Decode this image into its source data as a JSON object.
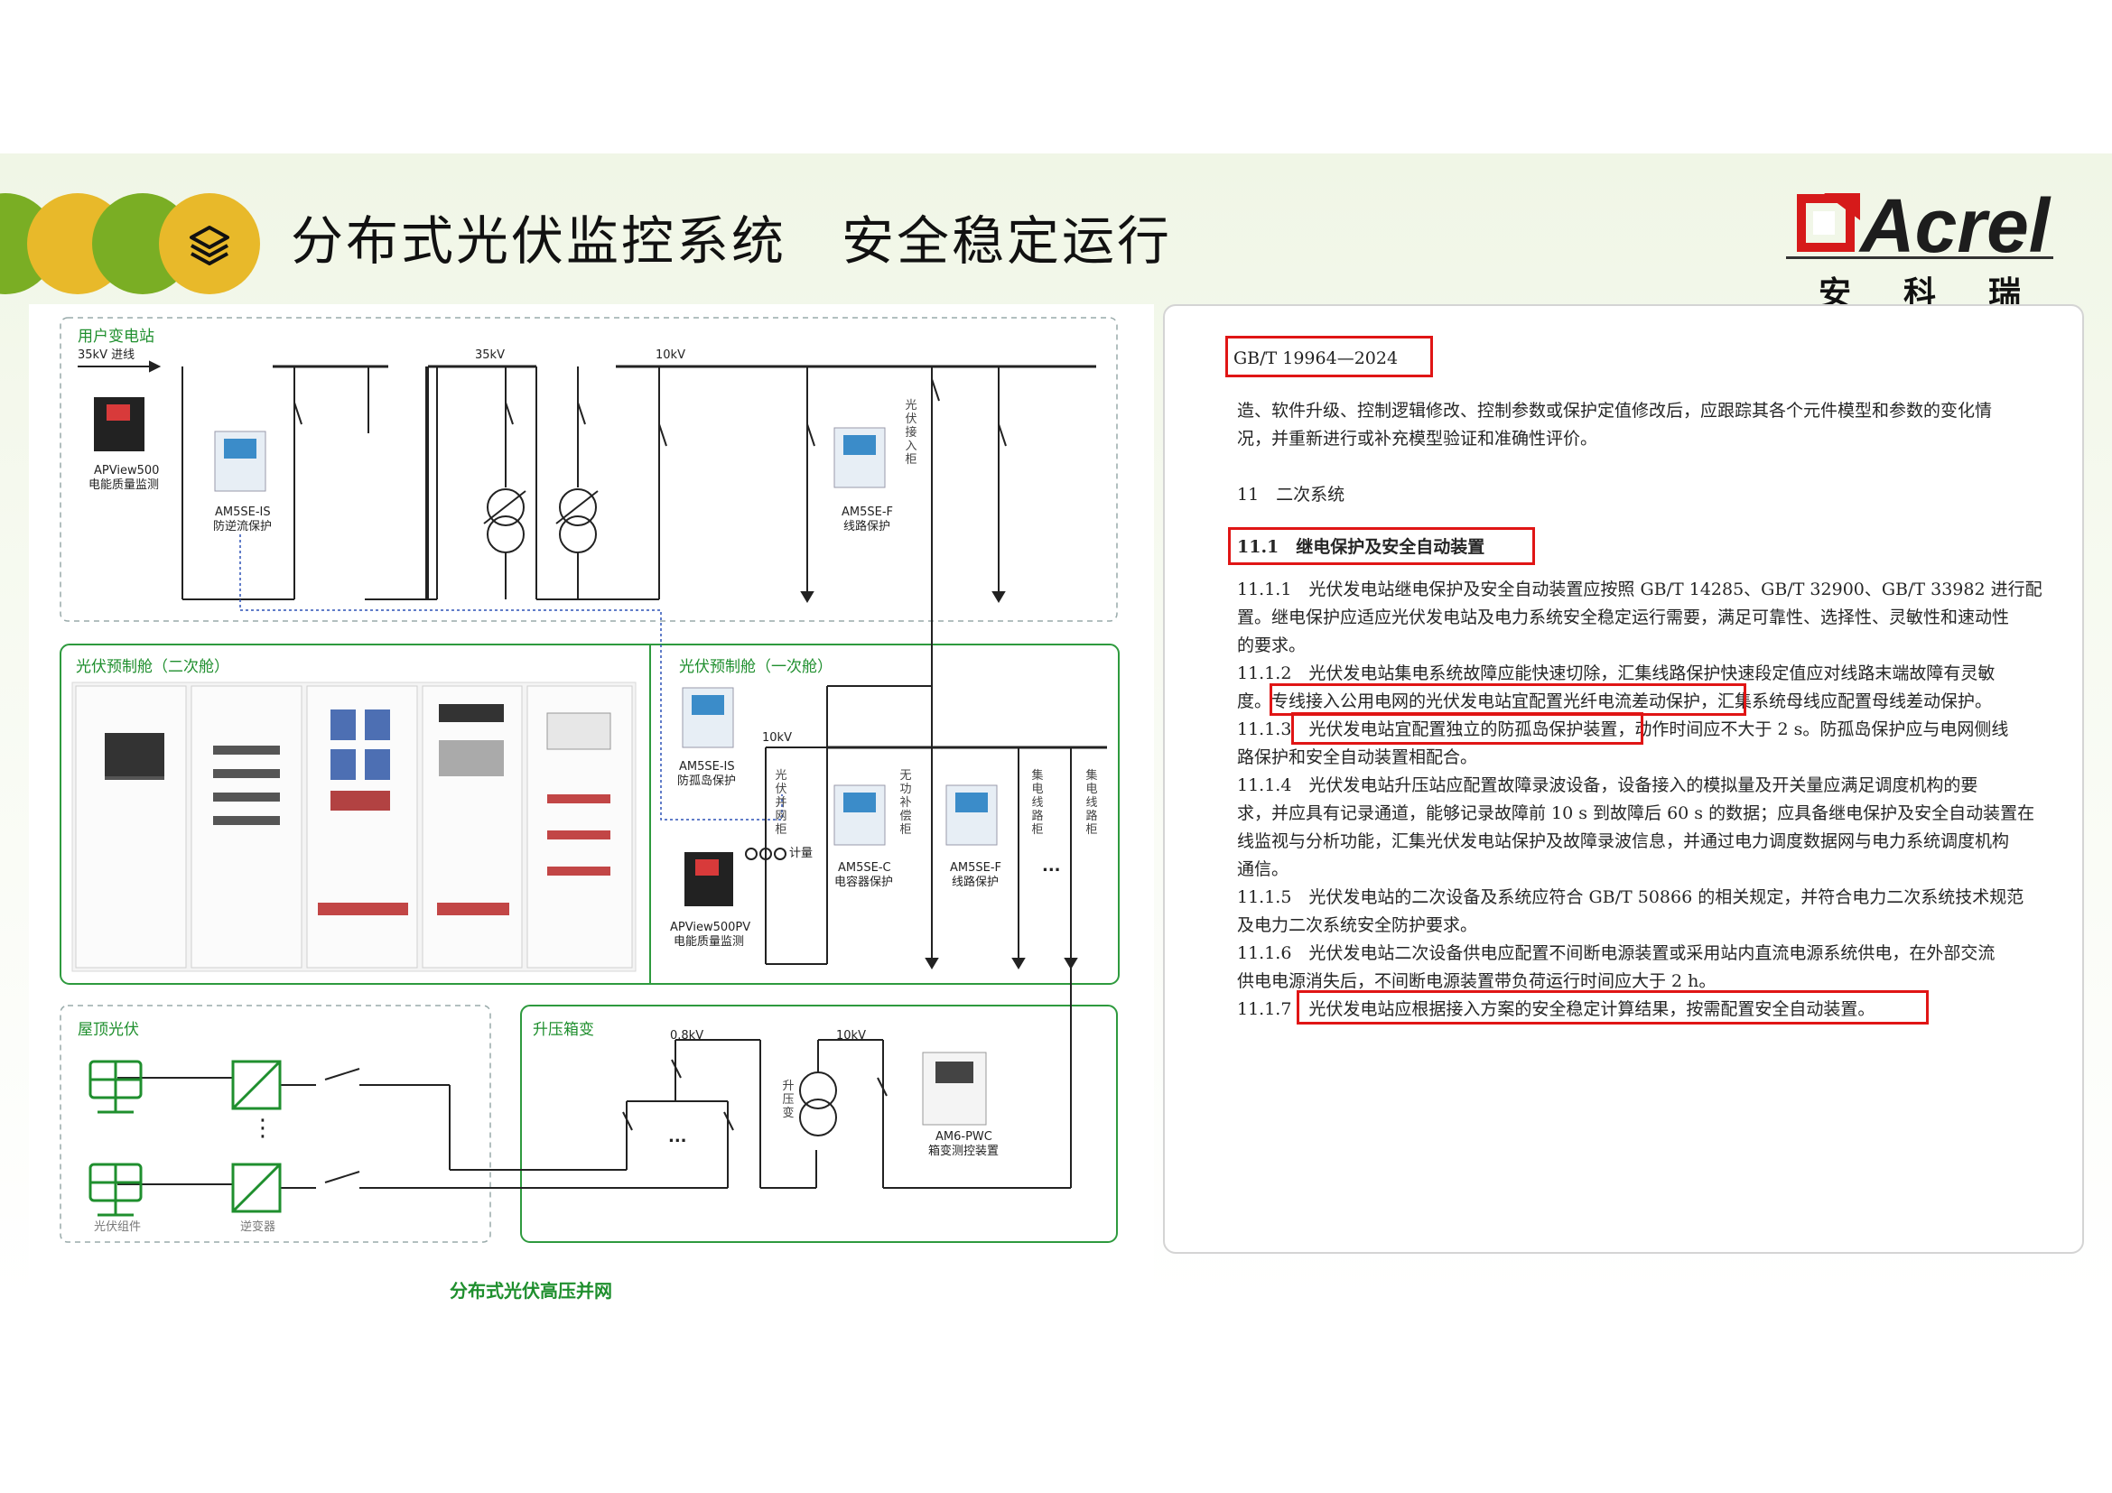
{
  "title": "分布式光伏监控系统　安全稳定运行",
  "logo": {
    "word": "Acrel",
    "cn": "安科瑞"
  },
  "colors": {
    "accent_green": "#1f8f2e",
    "circle_yellow": "#e8b92a",
    "circle_green": "#7aae24",
    "highlight_red": "#e01515"
  },
  "header_icon": "layers-icon",
  "diagram": {
    "caption": "分布式光伏高压并网",
    "substation": {
      "title": "用户变电站",
      "incoming": "35kV 进线",
      "bus35": "35kV",
      "bus10": "10kV",
      "apview": [
        "APView500",
        "电能质量监测"
      ],
      "am5se_is": [
        "AM5SE-IS",
        "防逆流保护"
      ],
      "am5se_f": [
        "AM5SE-F",
        "线路保护"
      ],
      "grid_cabinet": "光伏接入柜"
    },
    "cabin2": {
      "title": "光伏预制舱（二次舱）"
    },
    "cabin1": {
      "title": "光伏预制舱（一次舱）",
      "bus": "10kV",
      "am5se_is": [
        "AM5SE-IS",
        "防孤岛保护"
      ],
      "apview": [
        "APView500PV",
        "电能质量监测"
      ],
      "am5se_c": [
        "AM5SE-C",
        "电容器保护"
      ],
      "am5se_f": [
        "AM5SE-F",
        "线路保护"
      ],
      "metering": "计量",
      "pv_cabinet": "光伏并网柜",
      "reactive_cabinet": "无功补偿柜",
      "collector1": "集电线路柜",
      "collector2": "集电线路柜",
      "ellipsis": "..."
    },
    "rooftop": {
      "title": "屋顶光伏",
      "module": "光伏组件",
      "inverter": "逆变器",
      "dots": "⋮"
    },
    "boxsub": {
      "title": "升压箱变",
      "lv": "0.8kV",
      "hv": "10kV",
      "transformer": "升压变",
      "am6": [
        "AM6-PWC",
        "箱变测控装置"
      ],
      "ellipsis": "..."
    }
  },
  "document": {
    "standard": "GB/T 19964—2024",
    "lines": [
      "造、软件升级、控制逻辑修改、控制参数或保护定值修改后，应跟踪其各个元件模型和参数的变化情",
      "况，并重新进行或补充模型验证和准确性评价。",
      "11　二次系统",
      "11.1　继电保护及安全自动装置",
      "11.1.1　光伏发电站继电保护及安全自动装置应按照 GB/T 14285、GB/T 32900、GB/T 33982 进行配",
      "置。继电保护应适应光伏发电站及电力系统安全稳定运行需要，满足可靠性、选择性、灵敏性和速动性",
      "的要求。",
      "11.1.2　光伏发电站集电系统故障应能快速切除，汇集线路保护快速段定值应对线路末端故障有灵敏",
      "度。专线接入公用电网的光伏发电站宜配置光纤电流差动保护，汇集系统母线应配置母线差动保护。",
      "11.1.3　光伏发电站宜配置独立的防孤岛保护装置，动作时间应不大于 2 s。防孤岛保护应与电网侧线",
      "路保护和安全自动装置相配合。",
      "11.1.4　光伏发电站升压站应配置故障录波设备，设备接入的模拟量及开关量应满足调度机构的要",
      "求，并应具有记录通道，能够记录故障前 10 s 到故障后 60 s 的数据；应具备继电保护及安全自动装置在",
      "线监视与分析功能，汇集光伏发电站保护及故障录波信息，并通过电力调度数据网与电力系统调度机构",
      "通信。",
      "11.1.5　光伏发电站的二次设备及系统应符合 GB/T 50866 的相关规定，并符合电力二次系统技术规范",
      "及电力二次系统安全防护要求。",
      "11.1.6　光伏发电站二次设备供电应配置不间断电源装置或采用站内直流电源系统供电，在外部交流",
      "供电电源消失后，不间断电源装置带负荷运行时间应大于 2 h。",
      "11.1.7　光伏发电站应根据接入方案的安全稳定计算结果，按需配置安全自动装置。"
    ]
  }
}
